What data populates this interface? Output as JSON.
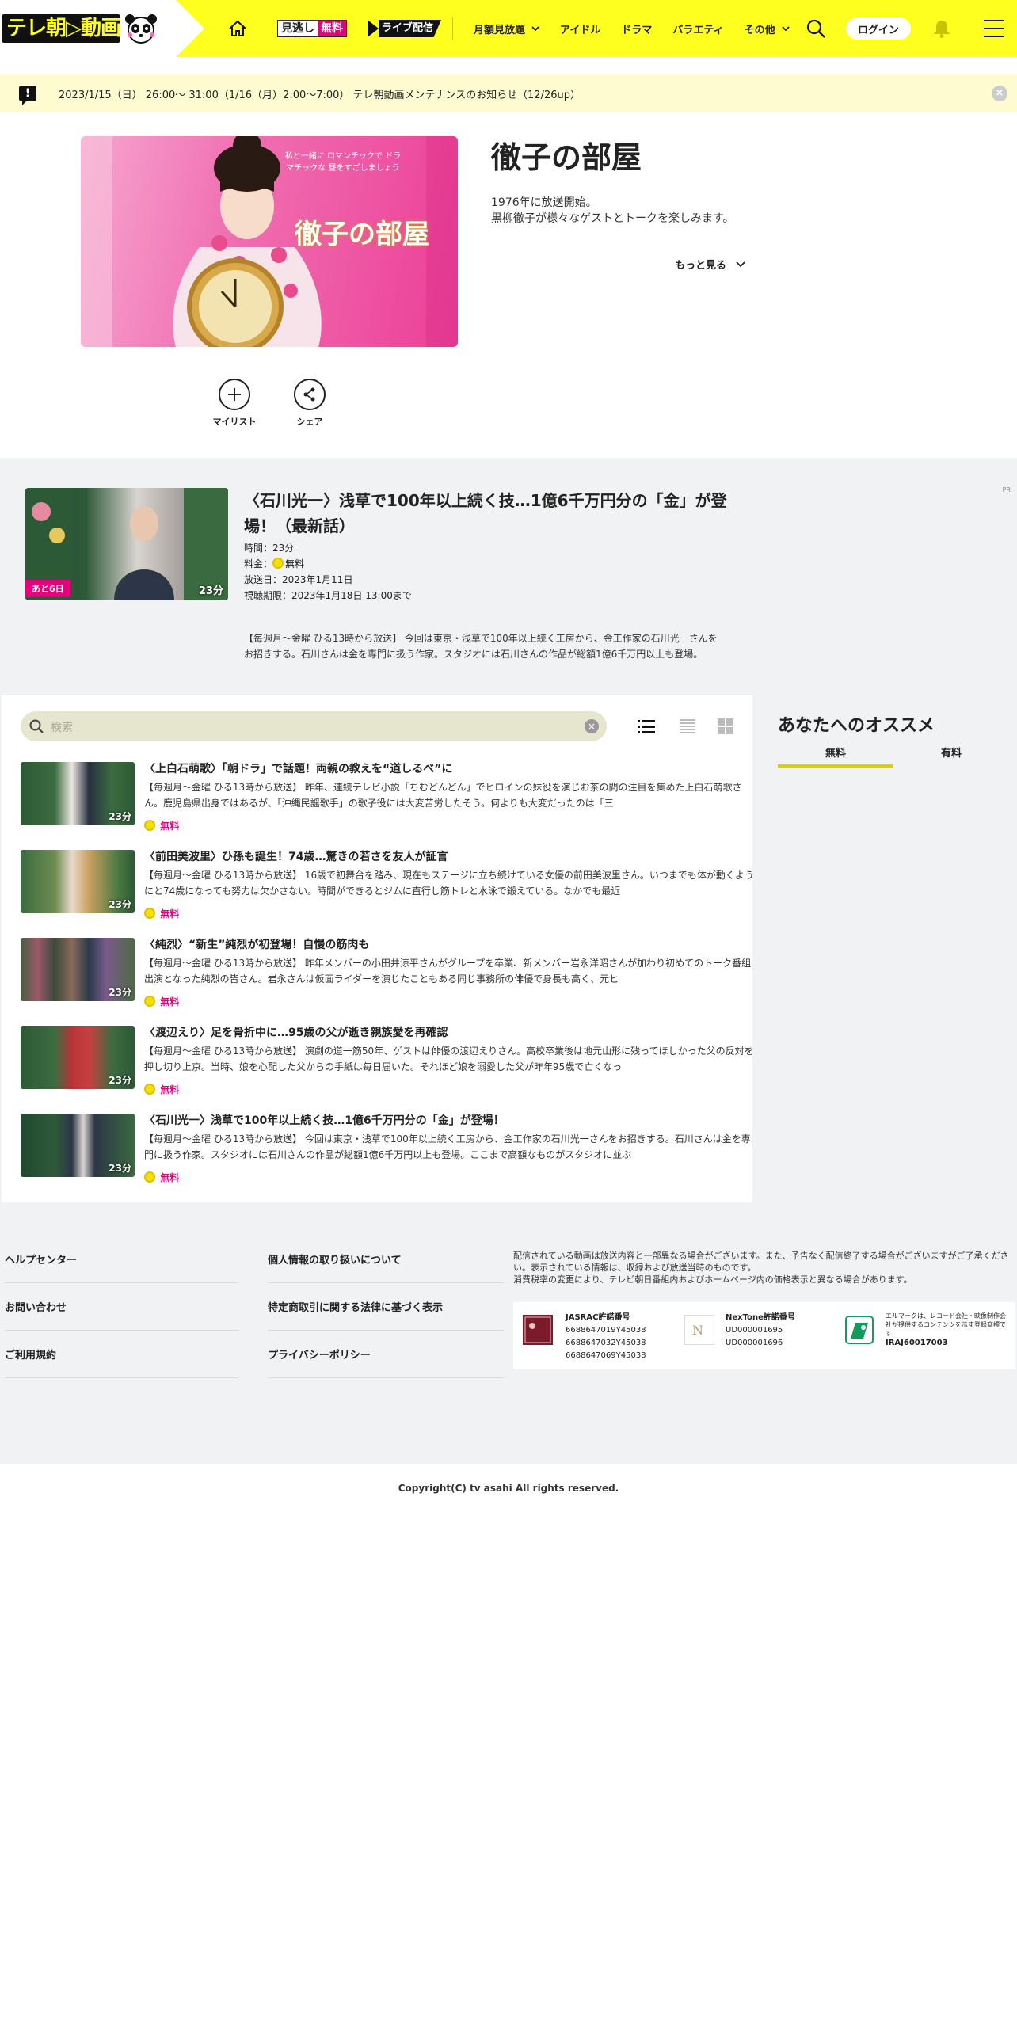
{
  "header": {
    "logo_text": "テレ朝▷動画",
    "free_badge": {
      "a": "見逃し",
      "b": "無料"
    },
    "live_badge": "ライブ配信",
    "nav": [
      {
        "label": "月額見放題",
        "dropdown": true
      },
      {
        "label": "アイドル",
        "dropdown": false
      },
      {
        "label": "ドラマ",
        "dropdown": false
      },
      {
        "label": "バラエティ",
        "dropdown": false
      },
      {
        "label": "その他",
        "dropdown": true
      }
    ],
    "login": "ログイン",
    "colors": {
      "brand": "#ffff1f",
      "accent": "#e6007e"
    }
  },
  "notice": {
    "text": "2023/1/15（日） 26:00～ 31:00（1/16（月）2:00〜7:00） テレ朝動画メンテナンスのお知らせ（12/26up）",
    "close": "×"
  },
  "program": {
    "image_text": "徹子の部屋",
    "image_caption": "私と一緒に ロマンチックで ドラマチックな 昼をすごしましょう",
    "title": "徹子の部屋",
    "desc_line1": "1976年に放送開始。",
    "desc_line2": "黒柳徹子が様々なゲストとトークを楽しみます。",
    "more": "もっと見る",
    "actions": {
      "mylist": "マイリスト",
      "share": "シェア"
    }
  },
  "latest": {
    "days_left": "あと6日",
    "duration": "23分",
    "title": "〈石川光一〉浅草で100年以上続く技…1億6千万円分の「金」が登場！（最新話）",
    "time": "時間：23分",
    "price_label": "料金：",
    "price": "無料",
    "air_date": "放送日：2023年1月11日",
    "deadline": "視聴期限：2023年1月18日 13:00まで",
    "body": "【毎週月～金曜 ひる13時から放送】 今回は東京・浅草で100年以上続く工房から、金工作家の石川光一さんをお招きする。石川さんは金を専門に扱う作家。スタジオには石川さんの作品が総額1億6千万円以上も登場。",
    "pr": "PR"
  },
  "search": {
    "placeholder": "検索",
    "clear": "×"
  },
  "episodes": [
    {
      "title": "〈上白石萌歌〉「朝ドラ」で話題！両親の教えを“道しるべ”に",
      "desc": "【毎週月～金曜 ひる13時から放送】 昨年、連続テレビ小説「ちむどんどん」でヒロインの妹役を演じお茶の間の注目を集めた上白石萌歌さん。鹿児島県出身ではあるが、「沖縄民謡歌手」の歌子役には大変苦労したそう。何よりも大変だったのは「三",
      "duration": "23分",
      "price": "無料"
    },
    {
      "title": "〈前田美波里〉ひ孫も誕生！74歳…驚きの若さを友人が証言",
      "desc": "【毎週月～金曜 ひる13時から放送】 16歳で初舞台を踏み、現在もステージに立ち続けている女優の前田美波里さん。いつまでも体が動くようにと74歳になっても努力は欠かさない。時間ができるとジムに直行し筋トレと水泳で鍛えている。なかでも最近",
      "duration": "23分",
      "price": "無料"
    },
    {
      "title": "〈純烈〉“新生”純烈が初登場！自慢の筋肉も",
      "desc": "【毎週月～金曜 ひる13時から放送】 昨年メンバーの小田井涼平さんがグループを卒業、新メンバー岩永洋昭さんが加わり初めてのトーク番組出演となった純烈の皆さん。岩永さんは仮面ライダーを演じたこともある同じ事務所の俳優で身長も高く、元ヒ",
      "duration": "23分",
      "price": "無料"
    },
    {
      "title": "〈渡辺えり〉足を骨折中に…95歳の父が逝き親族愛を再確認",
      "desc": "【毎週月～金曜 ひる13時から放送】 演劇の道一筋50年、ゲストは俳優の渡辺えりさん。高校卒業後は地元山形に残ってほしかった父の反対を押し切り上京。当時、娘を心配した父からの手紙は毎日届いた。それほど娘を溺愛した父が昨年95歳で亡くなっ",
      "duration": "23分",
      "price": "無料"
    },
    {
      "title": "〈石川光一〉浅草で100年以上続く技…1億6千万円分の「金」が登場！",
      "desc": "【毎週月～金曜 ひる13時から放送】 今回は東京・浅草で100年以上続く工房から、金工作家の石川光一さんをお招きする。石川さんは金を専門に扱う作家。スタジオには石川さんの作品が総額1億6千万円以上も登場。ここまで高額なものがスタジオに並ぶ",
      "duration": "23分",
      "price": "無料"
    }
  ],
  "recommend": {
    "title": "あなたへのオススメ",
    "tabs": [
      {
        "label": "無料",
        "active": true
      },
      {
        "label": "有料",
        "active": false
      }
    ]
  },
  "footer": {
    "links_col1": [
      "ヘルプセンター",
      "お問い合わせ",
      "ご利用規約"
    ],
    "links_col2": [
      "個人情報の取り扱いについて",
      "特定商取引に関する法律に基づく表示",
      "プライバシーポリシー"
    ],
    "note_line1": "配信されている動画は放送内容と一部異なる場合がございます。また、予告なく配信終了する場合がございますがご了承ください。表示されている情報は、収録および放送当時のものです。",
    "note_line2": "消費税率の変更により、テレビ朝日番組内およびホームページ内の価格表示と異なる場合があります。",
    "licenses": {
      "jasrac": {
        "title": "JASRAC許諾番号",
        "numbers": [
          "6688647019Y45038",
          "6688647032Y45038",
          "6688647069Y45038"
        ]
      },
      "nextone": {
        "title": "NexTone許諾番号",
        "numbers": [
          "UD000001695",
          "UD000001696"
        ]
      },
      "lmark": {
        "desc": "エルマークは、レコード会社・映像制作会社が提供するコンテンツを示す登録商標です",
        "number": "IRAJ60017003"
      }
    },
    "copyright": "Copyright(C) tv asahi All rights reserved."
  }
}
